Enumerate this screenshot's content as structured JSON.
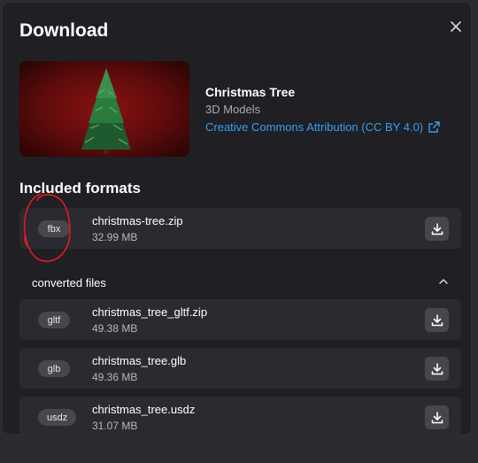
{
  "dialog": {
    "title": "Download",
    "close_icon": "close-icon"
  },
  "asset": {
    "name": "Christmas Tree",
    "category": "3D Models",
    "license": "Creative Commons Attribution (CC BY 4.0)",
    "license_icon": "external-link-icon"
  },
  "included": {
    "heading": "Included formats",
    "files": [
      {
        "format": "fbx",
        "filename": "christmas-tree.zip",
        "size": "32.99 MB"
      }
    ]
  },
  "converted": {
    "label": "converted files",
    "toggle_icon": "chevron-up-icon",
    "files": [
      {
        "format": "gltf",
        "filename": "christmas_tree_gltf.zip",
        "size": "49.38 MB"
      },
      {
        "format": "glb",
        "filename": "christmas_tree.glb",
        "size": "49.36 MB"
      },
      {
        "format": "usdz",
        "filename": "christmas_tree.usdz",
        "size": "31.07 MB"
      }
    ]
  },
  "download_icon": "download-icon",
  "colors": {
    "modal_bg": "#1f1f24",
    "row_bg": "#2a2a30",
    "link": "#35a1f1",
    "annotation": "#e01b1b"
  }
}
